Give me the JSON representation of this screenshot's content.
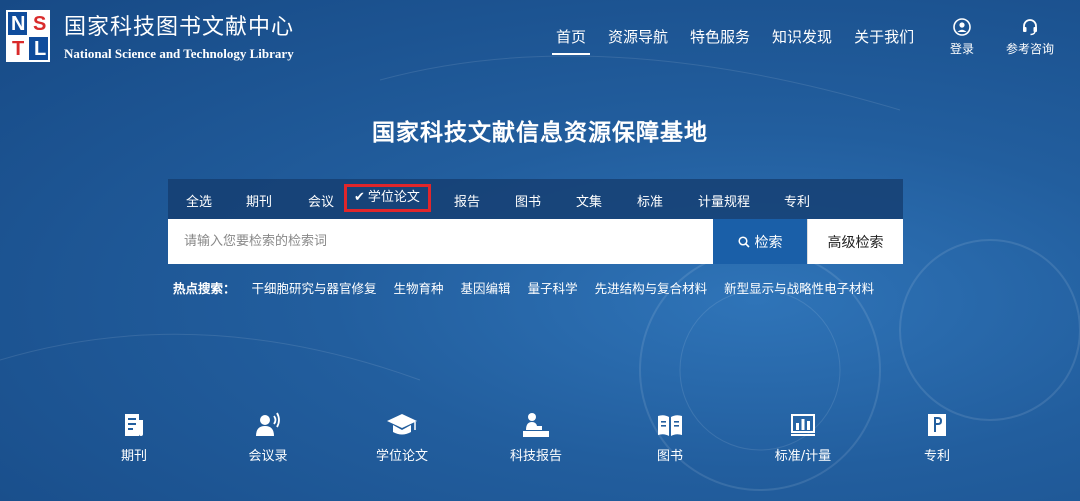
{
  "colors": {
    "background": "#225e9e",
    "tab_bar": "#143c6e",
    "search_button": "#1a5fa8",
    "selected_outline": "#e0262b",
    "logo_blue": "#0f4c9c",
    "logo_red": "#d92b2b"
  },
  "logo": {
    "letters": [
      "N",
      "S",
      "T",
      "L"
    ],
    "title_cn": "国家科技图书文献中心",
    "title_en": "National Science and Technology Library"
  },
  "nav": {
    "items": [
      "首页",
      "资源导航",
      "特色服务",
      "知识发现",
      "关于我们"
    ],
    "active": "首页"
  },
  "header_tools": {
    "login": "登录",
    "consult": "参考咨询",
    "login_icon": "user-icon",
    "consult_icon": "headset-icon"
  },
  "hero": {
    "title": "国家科技文献信息资源保障基地"
  },
  "search": {
    "tabs": [
      "全选",
      "期刊",
      "会议",
      "学位论文",
      "报告",
      "图书",
      "文集",
      "标准",
      "计量规程",
      "专利"
    ],
    "selected_tab": "学位论文",
    "placeholder": "请输入您要检索的检索词",
    "search_button": "检索",
    "advanced_button": "高级检索"
  },
  "hot": {
    "label": "热点搜索：",
    "items": [
      "干细胞研究与器官修复",
      "生物育种",
      "基因编辑",
      "量子科学",
      "先进结构与复合材料",
      "新型显示与战略性电子材料"
    ]
  },
  "categories": [
    {
      "label": "期刊",
      "icon": "journal-icon"
    },
    {
      "label": "会议录",
      "icon": "conference-icon"
    },
    {
      "label": "学位论文",
      "icon": "graduation-cap-icon"
    },
    {
      "label": "科技报告",
      "icon": "report-icon"
    },
    {
      "label": "图书",
      "icon": "book-icon"
    },
    {
      "label": "标准/计量",
      "icon": "standard-chart-icon"
    },
    {
      "label": "专利",
      "icon": "patent-icon"
    }
  ]
}
